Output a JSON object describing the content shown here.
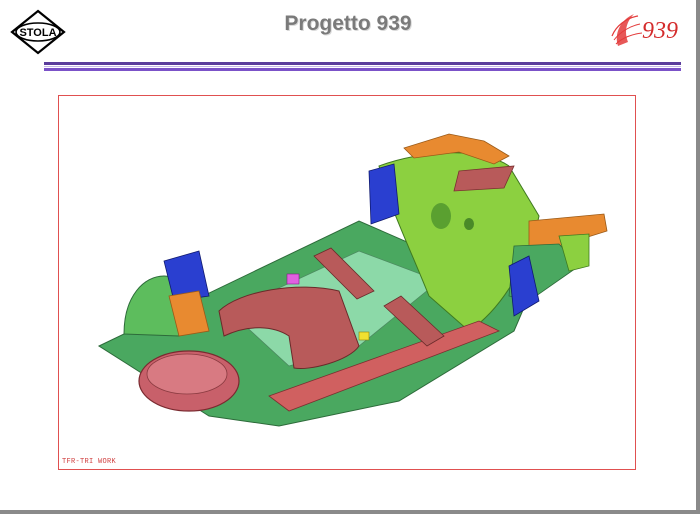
{
  "slide": {
    "title": "Progetto 939",
    "logo_left_text": "STOLA",
    "logo_right_text": "939",
    "image_caption": "TFR-TRI WORK"
  },
  "colors": {
    "rule_dark": "#5b3d9c",
    "rule_light": "#7b52c8",
    "frame_border": "#e05050",
    "floor_green": "#4aa860",
    "body_yellowgreen": "#8cd040",
    "wheelhouse_red": "#b85a5a",
    "spare_well": "#c8606a",
    "reinforcement_blue": "#2a3fd0",
    "bracket_orange": "#e88a30"
  },
  "icons": {
    "logo_left": "stola-logo-icon",
    "logo_right": "939-emblem-icon"
  }
}
